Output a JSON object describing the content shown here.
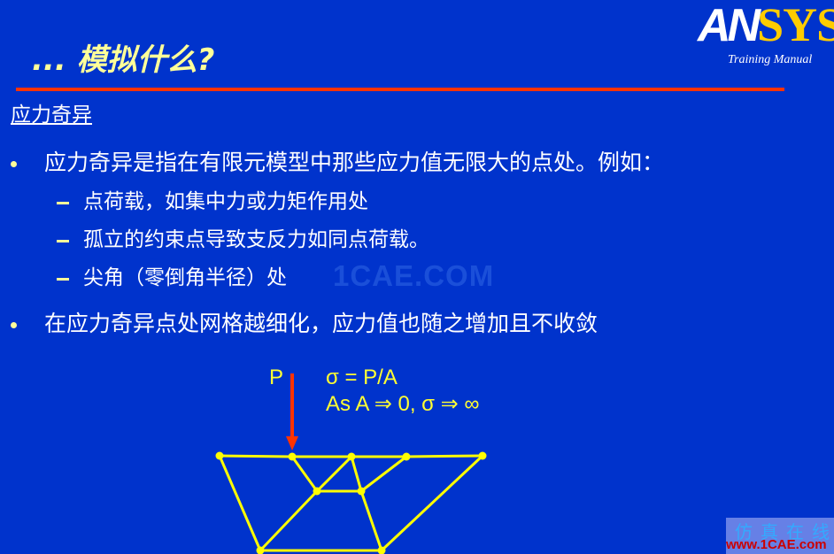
{
  "header": {
    "logo_left": "AN",
    "logo_right": "SYS",
    "training_label": "Training Manual",
    "title": "... 模拟什么?",
    "accent_rule_color": "#ff3300"
  },
  "section": {
    "subtitle": "应力奇异"
  },
  "content": {
    "bullets": [
      {
        "text": "应力奇异是指在有限元模型中那些应力值无限大的点处。例如：",
        "sub_items": [
          "点荷载，如集中力或力矩作用处",
          "孤立的约束点导致支反力如同点荷载。",
          "尖角（零倒角半径）处"
        ]
      },
      {
        "text": "在应力奇异点处网格越细化，应力值也随之增加且不收敛",
        "sub_items": []
      }
    ]
  },
  "watermark": "1CAE.COM",
  "diagram": {
    "load_label": "P",
    "formula_line1": "σ = P/A",
    "formula_line2": "As A ⇒ 0, σ ⇒ ∞",
    "arrow_color": "#ff3300",
    "mesh_color": "#ffff00"
  },
  "footer": {
    "site_cn": "仿真在线",
    "site_url": "www.1CAE.com"
  }
}
